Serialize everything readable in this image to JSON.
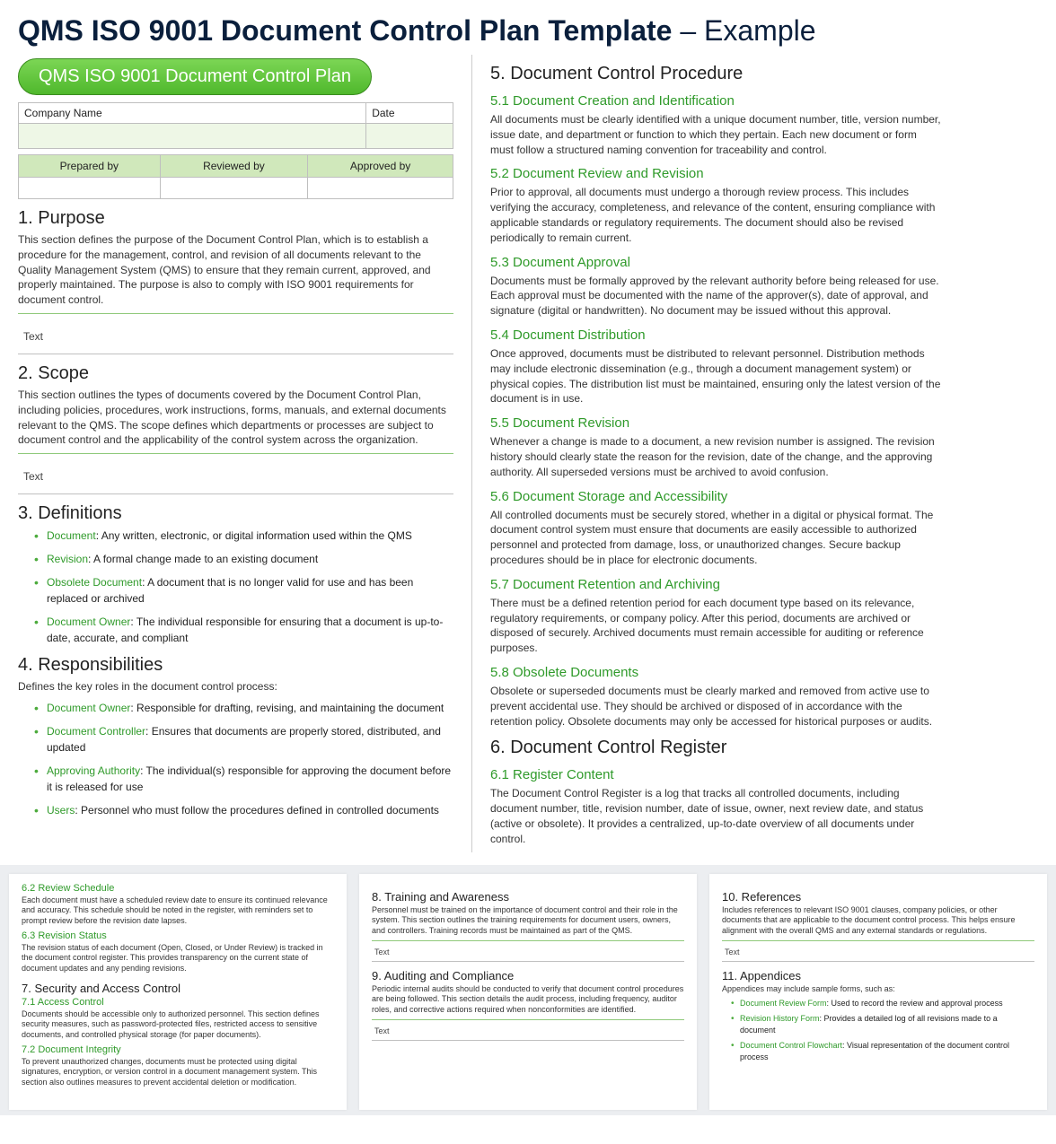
{
  "title_bold": "QMS ISO 9001 Document Control Plan Template",
  "title_light": " – Example",
  "pill": "QMS ISO 9001 Document Control Plan",
  "form": {
    "company_label": "Company Name",
    "date_label": "Date",
    "company_value": "",
    "date_value": "",
    "prepared_label": "Prepared by",
    "reviewed_label": "Reviewed by",
    "approved_label": "Approved by"
  },
  "s1_h": "1. Purpose",
  "s1_d": "This section defines the purpose of the Document Control Plan, which is to establish a procedure for the management, control, and revision of all documents relevant to the Quality Management System (QMS) to ensure that they remain current, approved, and properly maintained. The purpose is also to comply with ISO 9001 requirements for document control.",
  "s2_h": "2. Scope",
  "s2_d": "This section outlines the types of documents covered by the Document Control Plan, including policies, procedures, work instructions, forms, manuals, and external documents relevant to the QMS. The scope defines which departments or processes are subject to document control and the applicability of the control system across the organization.",
  "ph_text": "Text",
  "s3_h": "3. Definitions",
  "defs": [
    {
      "t": "Document",
      "d": ": Any written, electronic, or digital information used within the QMS"
    },
    {
      "t": "Revision",
      "d": ": A formal change made to an existing document"
    },
    {
      "t": "Obsolete Document",
      "d": ": A document that is no longer valid for use and has been replaced or archived"
    },
    {
      "t": "Document Owner",
      "d": ": The individual responsible for ensuring that a document is up-to-date, accurate, and compliant"
    }
  ],
  "s4_h": "4. Responsibilities",
  "s4_d": "Defines the key roles in the document control process:",
  "resp": [
    {
      "t": "Document Owner",
      "d": ": Responsible for drafting, revising, and maintaining the document"
    },
    {
      "t": "Document Controller",
      "d": ": Ensures that documents are properly stored, distributed, and updated"
    },
    {
      "t": "Approving Authority",
      "d": ": The individual(s) responsible for approving the document before it is released for use"
    },
    {
      "t": "Users",
      "d": ": Personnel who must follow the procedures defined in controlled documents"
    }
  ],
  "s5_h": "5. Document Control Procedure",
  "s51_h": "5.1   Document Creation and Identification",
  "s51_d": "All documents must be clearly identified with a unique document number, title, version number, issue date, and department or function to which they pertain. Each new document or form must follow a structured naming convention for traceability and control.",
  "s52_h": "5.2   Document Review and Revision",
  "s52_d": "Prior to approval, all documents must undergo a thorough review process. This includes verifying the accuracy, completeness, and relevance of the content, ensuring compliance with applicable standards or regulatory requirements. The document should also be revised periodically to remain current.",
  "s53_h": "5.3   Document Approval",
  "s53_d": "Documents must be formally approved by the relevant authority before being released for use. Each approval must be documented with the name of the approver(s), date of approval, and signature (digital or handwritten). No document may be issued without this approval.",
  "s54_h": "5.4   Document Distribution",
  "s54_d": "Once approved, documents must be distributed to relevant personnel. Distribution methods may include electronic dissemination (e.g., through a document management system) or physical copies. The distribution list must be maintained, ensuring only the latest version of the document is in use.",
  "s55_h": "5.5   Document Revision",
  "s55_d": "Whenever a change is made to a document, a new revision number is assigned. The revision history should clearly state the reason for the revision, date of the change, and the approving authority. All superseded versions must be archived to avoid confusion.",
  "s56_h": "5.6   Document Storage and Accessibility",
  "s56_d": "All controlled documents must be securely stored, whether in a digital or physical format. The document control system must ensure that documents are easily accessible to authorized personnel and protected from damage, loss, or unauthorized changes. Secure backup procedures should be in place for electronic documents.",
  "s57_h": "5.7   Document Retention and Archiving",
  "s57_d": "There must be a defined retention period for each document type based on its relevance, regulatory requirements, or company policy. After this period, documents are archived or disposed of securely. Archived documents must remain accessible for auditing or reference purposes.",
  "s58_h": "5.8   Obsolete Documents",
  "s58_d": "Obsolete or superseded documents must be clearly marked and removed from active use to prevent accidental use. They should be archived or disposed of in accordance with the retention policy. Obsolete documents may only be accessed for historical purposes or audits.",
  "s6_h": "6. Document Control Register",
  "s61_h": "6.1   Register Content",
  "s61_d": "The Document Control Register is a log that tracks all controlled documents, including document number, title, revision number, date of issue, owner, next review date, and status (active or obsolete). It provides a centralized, up-to-date overview of all documents under control.",
  "t1": {
    "s62_h": "6.2  Review Schedule",
    "s62_d": "Each document must have a scheduled review date to ensure its continued relevance and accuracy. This schedule should be noted in the register, with reminders set to prompt review before the revision date lapses.",
    "s63_h": "6.3  Revision Status",
    "s63_d": "The revision status of each document (Open, Closed, or Under Review) is tracked in the document control register. This provides transparency on the current state of document updates and any pending revisions.",
    "s7_h": "7. Security and Access Control",
    "s71_h": "7.1  Access Control",
    "s71_d": "Documents should be accessible only to authorized personnel. This section defines security measures, such as password-protected files, restricted access to sensitive documents, and controlled physical storage (for paper documents).",
    "s72_h": "7.2  Document Integrity",
    "s72_d": "To prevent unauthorized changes, documents must be protected using digital signatures, encryption, or version control in a document management system. This section also outlines measures to prevent accidental deletion or modification."
  },
  "t2": {
    "s8_h": "8. Training and Awareness",
    "s8_d": "Personnel must be trained on the importance of document control and their role in the system. This section outlines the training requirements for document users, owners, and controllers. Training records must be maintained as part of the QMS.",
    "s9_h": "9. Auditing and Compliance",
    "s9_d": "Periodic internal audits should be conducted to verify that document control procedures are being followed. This section details the audit process, including frequency, auditor roles, and corrective actions required when nonconformities are identified."
  },
  "t3": {
    "s10_h": "10. References",
    "s10_d": "Includes references to relevant ISO 9001 clauses, company policies, or other documents that are applicable to the document control process. This helps ensure alignment with the overall QMS and any external standards or regulations.",
    "s11_h": "11. Appendices",
    "s11_d": "Appendices may include sample forms, such as:",
    "app": [
      {
        "t": "Document Review Form",
        "d": ": Used to record the review and approval process"
      },
      {
        "t": "Revision History Form",
        "d": ": Provides a detailed log of all revisions made to a document"
      },
      {
        "t": "Document Control Flowchart",
        "d": ": Visual representation of the document control process"
      }
    ]
  }
}
